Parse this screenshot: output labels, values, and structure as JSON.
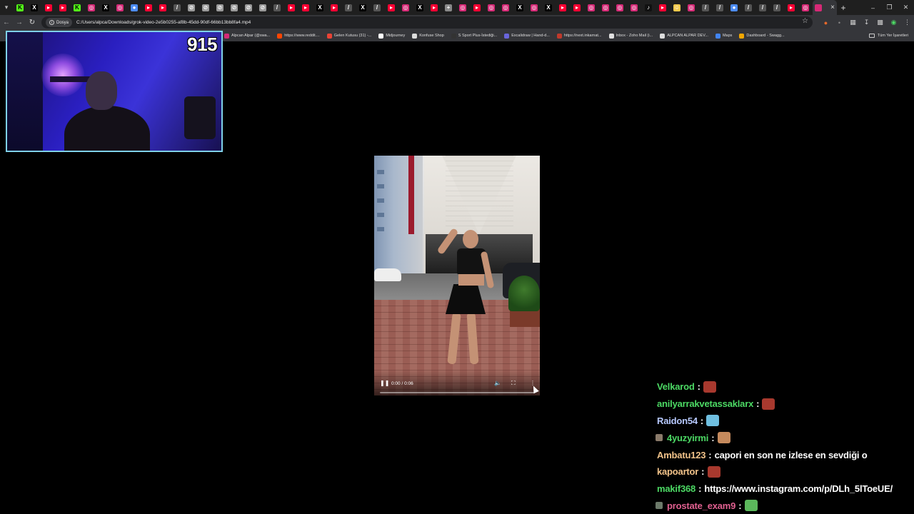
{
  "browser": {
    "tab_favicons": [
      "kick-icon",
      "x-icon",
      "youtube-icon",
      "youtube-icon",
      "kick-icon",
      "instagram-icon",
      "x-icon",
      "instagram-icon",
      "browser-icon",
      "youtube-icon",
      "youtube-icon",
      "pen-icon",
      "globe-icon",
      "globe-icon",
      "globe-icon",
      "globe-icon",
      "globe-icon",
      "globe-icon",
      "pen-icon",
      "youtube-icon",
      "youtube-icon",
      "x-icon",
      "youtube-icon",
      "pen-icon",
      "x-icon",
      "pen-icon",
      "youtube-icon",
      "instagram-icon",
      "x-icon",
      "youtube-icon",
      "sparkle-icon",
      "instagram-icon",
      "youtube-icon",
      "instagram-icon",
      "instagram-icon",
      "x-icon",
      "instagram-icon",
      "x-icon",
      "youtube-icon",
      "youtube-icon",
      "instagram-icon",
      "instagram-icon",
      "instagram-icon",
      "instagram-icon",
      "tiktok-icon",
      "youtube-icon",
      "smile-icon",
      "instagram-icon",
      "pen-icon",
      "pen-icon",
      "browser-icon",
      "pen-icon",
      "pen-icon",
      "pen-icon",
      "youtube-icon",
      "instagram-icon"
    ],
    "address": {
      "chip_label": "Dosya",
      "url": "C:/Users/alpca/Downloads/grok-video-2e5b0255-af8b-45dd-90df-66bb13bb8fa4.mp4"
    },
    "bookmarks": [
      {
        "label": "Alpcan Alpar (@swa...",
        "color": "#d62976"
      },
      {
        "label": "https://www.reddit....",
        "color": "#ff4500"
      },
      {
        "label": "Gelen Kutusu (31) -...",
        "color": "#ea4335"
      },
      {
        "label": "Midjourney",
        "color": "#ffffff"
      },
      {
        "label": "Konfuse Shop",
        "color": "#dddddd"
      },
      {
        "label": "S Sport Plus-İstediği...",
        "color": "#333333"
      },
      {
        "label": "Excalidraw | Hand-d...",
        "color": "#6965db"
      },
      {
        "label": "https://next.inkarnat...",
        "color": "#c0392b"
      },
      {
        "label": "Inbox - Zoho Mail (i...",
        "color": "#e0e0e0"
      },
      {
        "label": "ALPCAN ALPAR DEV...",
        "color": "#dddddd"
      },
      {
        "label": "Maps",
        "color": "#4285f4"
      },
      {
        "label": "Dashboard - Swagg...",
        "color": "#f4a700"
      }
    ],
    "all_bookmarks_label": "Tüm Yer İşaretleri"
  },
  "webcam": {
    "viewer_count": "915",
    "border_color": "#7fd1e8"
  },
  "video": {
    "time": "0:00 / 0:06",
    "progress": 0.0
  },
  "chat": [
    {
      "user": "Velkarod",
      "color": "#4cd964",
      "text": "",
      "emote": "#a8392e",
      "badge": ""
    },
    {
      "user": "anilyarrakvetassaklarx",
      "color": "#4cd964",
      "text": "",
      "emote": "#a8392e",
      "badge": ""
    },
    {
      "user": "Raidon54",
      "color": "#b7c9ff",
      "text": "",
      "emote": "#6fbfe0",
      "badge": ""
    },
    {
      "user": "4yuzyirmi",
      "color": "#4cd964",
      "text": "",
      "emote": "#c58a5d",
      "badge": "#8a7a6a"
    },
    {
      "user": "Ambatu123",
      "color": "#f2c38a",
      "text": "capori en son ne izlese en sevdiği o",
      "emote": "",
      "badge": ""
    },
    {
      "user": "kapoartor",
      "color": "#f2c38a",
      "text": "",
      "emote": "#a8392e",
      "badge": ""
    },
    {
      "user": "makif368",
      "color": "#4cd964",
      "text": "https://www.instagram.com/p/DLh_5lToeUE/",
      "emote": "",
      "badge": ""
    },
    {
      "user": "prostate_exam9",
      "color": "#e06090",
      "text": "",
      "emote": "#5cb85c",
      "badge": "#6c7a6a"
    }
  ]
}
